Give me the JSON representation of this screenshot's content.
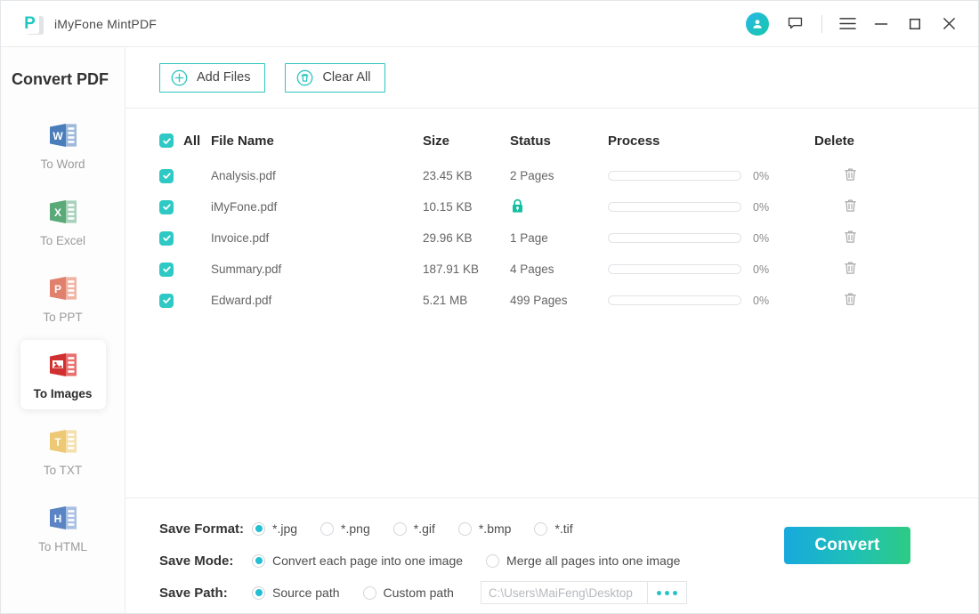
{
  "window": {
    "app_title": "iMyFone MintPDF",
    "logo_letter": "P",
    "icons": {
      "account": "account-icon",
      "feedback": "feedback-icon",
      "menu": "hamburger-menu-icon",
      "minimize": "minimize-icon",
      "maximize": "maximize-icon",
      "close": "close-icon"
    },
    "accent_color": "#2ec9c4",
    "convert_gradient_from": "#17a9dd",
    "convert_gradient_to": "#2ecb84"
  },
  "sidebar": {
    "title": "Convert PDF",
    "items": [
      {
        "label": "To Word",
        "icon": "word-doc-icon",
        "color": "#4a7ebb",
        "letter": "W",
        "active": false
      },
      {
        "label": "To Excel",
        "icon": "excel-doc-icon",
        "color": "#5aa978",
        "letter": "X",
        "active": false
      },
      {
        "label": "To PPT",
        "icon": "ppt-doc-icon",
        "color": "#e0816d",
        "letter": "P",
        "active": false
      },
      {
        "label": "To Images",
        "icon": "image-doc-icon",
        "color": "#d0302f",
        "letter": "",
        "active": true
      },
      {
        "label": "To TXT",
        "icon": "txt-doc-icon",
        "color": "#edc875",
        "letter": "T",
        "active": false
      },
      {
        "label": "To HTML",
        "icon": "html-doc-icon",
        "color": "#5a84c4",
        "letter": "H",
        "active": false
      }
    ]
  },
  "toolbar": {
    "add_files_label": "Add Files",
    "clear_all_label": "Clear All"
  },
  "table": {
    "select_all_label": "All",
    "select_all_checked": true,
    "columns": {
      "file_name": "File Name",
      "size": "Size",
      "status": "Status",
      "process": "Process",
      "delete": "Delete"
    },
    "rows": [
      {
        "checked": true,
        "name": "Analysis.pdf",
        "size": "23.45 KB",
        "status": "2 Pages",
        "locked": false,
        "percent": "0%"
      },
      {
        "checked": true,
        "name": "iMyFone.pdf",
        "size": "10.15 KB",
        "status": "",
        "locked": true,
        "percent": "0%"
      },
      {
        "checked": true,
        "name": "Invoice.pdf",
        "size": "29.96 KB",
        "status": "1 Page",
        "locked": false,
        "percent": "0%"
      },
      {
        "checked": true,
        "name": "Summary.pdf",
        "size": "187.91 KB",
        "status": "4 Pages",
        "locked": false,
        "percent": "0%"
      },
      {
        "checked": true,
        "name": "Edward.pdf",
        "size": "5.21 MB",
        "status": "499 Pages",
        "locked": false,
        "percent": "0%"
      }
    ]
  },
  "settings": {
    "save_format": {
      "label": "Save Format:",
      "options": [
        {
          "label": "*.jpg",
          "selected": true
        },
        {
          "label": "*.png",
          "selected": false
        },
        {
          "label": "*.gif",
          "selected": false
        },
        {
          "label": "*.bmp",
          "selected": false
        },
        {
          "label": "*.tif",
          "selected": false
        }
      ]
    },
    "save_mode": {
      "label": "Save Mode:",
      "options": [
        {
          "label": "Convert each page into one image",
          "selected": true
        },
        {
          "label": "Merge all pages into one image",
          "selected": false
        }
      ]
    },
    "save_path": {
      "label": "Save Path:",
      "options": [
        {
          "label": "Source path",
          "selected": true
        },
        {
          "label": "Custom path",
          "selected": false
        }
      ],
      "path_value": "C:\\Users\\MaiFeng\\Desktop",
      "browse_icon": "ellipsis-icon"
    },
    "convert_label": "Convert"
  }
}
